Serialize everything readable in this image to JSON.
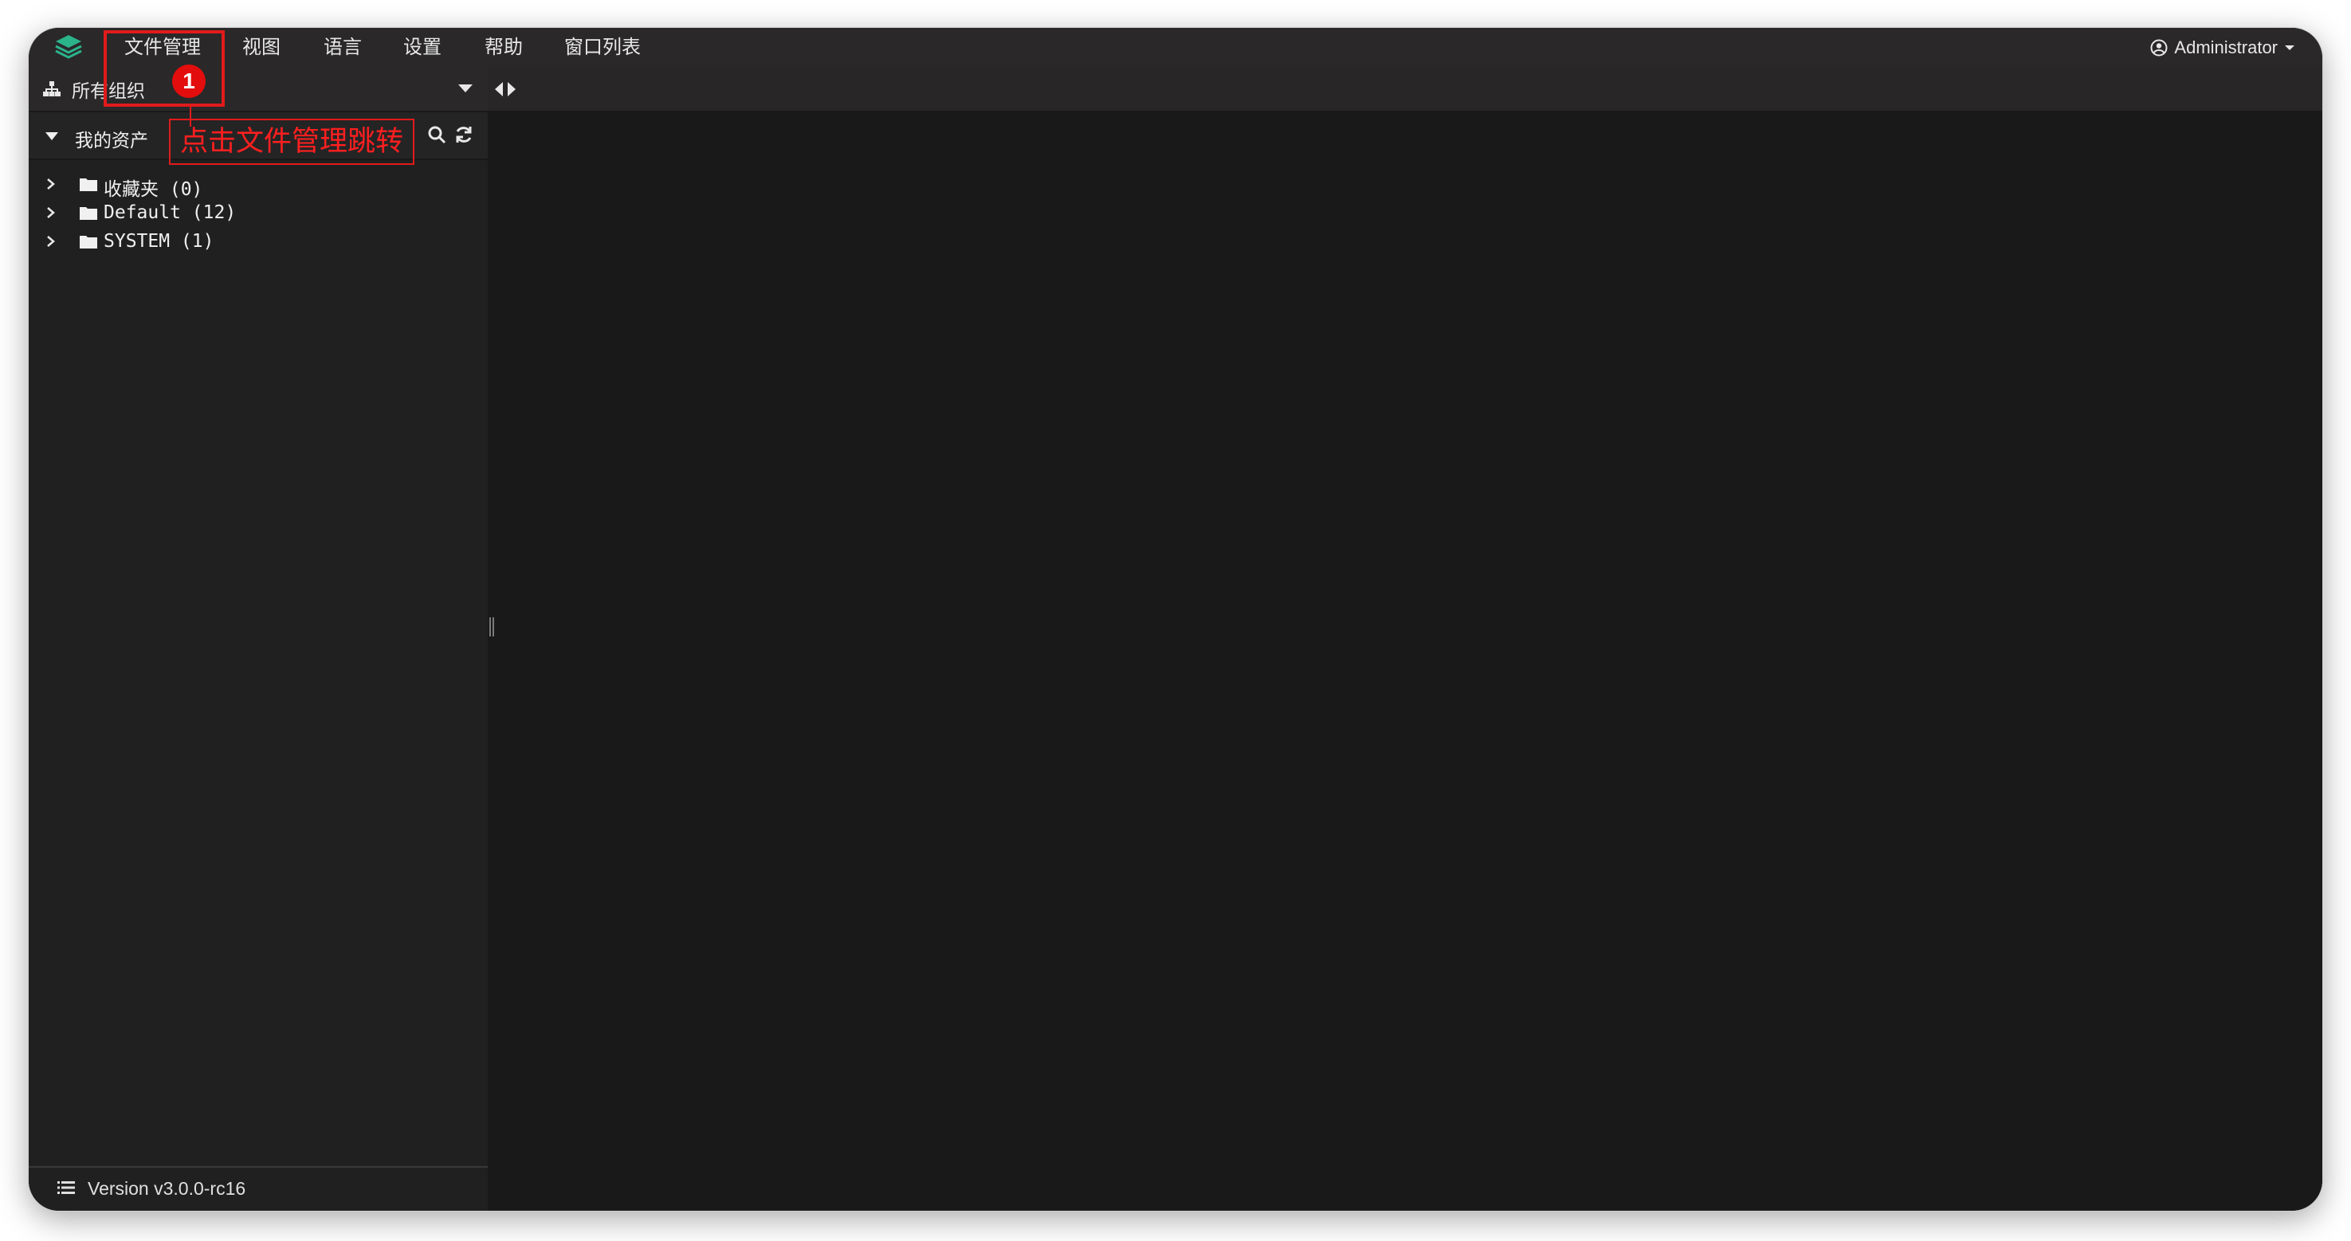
{
  "menubar": {
    "items": [
      {
        "label": "文件管理"
      },
      {
        "label": "视图"
      },
      {
        "label": "语言"
      },
      {
        "label": "设置"
      },
      {
        "label": "帮助"
      },
      {
        "label": "窗口列表"
      }
    ],
    "account": {
      "label": "Administrator",
      "icon": "user-circle-icon"
    }
  },
  "sidebar": {
    "org_selector": {
      "label": "所有组织",
      "icon": "sitemap-icon"
    },
    "assets_header": {
      "label": "我的资产",
      "search_icon": "search-icon",
      "refresh_icon": "refresh-icon"
    },
    "tree": [
      {
        "label": "收藏夹 (0)"
      },
      {
        "label": "Default (12)"
      },
      {
        "label": "SYSTEM (1)"
      }
    ],
    "footer": {
      "version": "Version v3.0.0-rc16"
    }
  },
  "annotation": {
    "badge": "1",
    "text": "点击文件管理跳转"
  },
  "colors": {
    "background": "#1c1b1c",
    "menubar": "#2a2829",
    "sidebar": "#212021",
    "annotation": "#e11b1b"
  }
}
